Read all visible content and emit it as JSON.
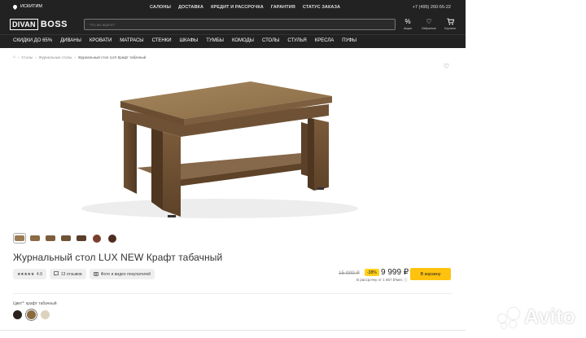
{
  "header": {
    "city": "ИСКИТИМ",
    "topnav": [
      "САЛОНЫ",
      "ДОСТАВКА",
      "КРЕДИТ И РАССРОЧКА",
      "ГАРАНТИЯ",
      "СТАТУС ЗАКАЗА"
    ],
    "phone": "+7 (495) 260-55-22",
    "logo_box": "DIVAN",
    "logo_text": "BOSS",
    "search_placeholder": "Что вы ищете?",
    "icons": [
      {
        "icon": "percent-icon",
        "label": "Акции"
      },
      {
        "icon": "heart-icon",
        "label": "Избранное"
      },
      {
        "icon": "cart-icon",
        "label": "Корзина"
      }
    ],
    "categories": [
      "СКИДКИ ДО 65%",
      "ДИВАНЫ",
      "КРОВАТИ",
      "МАТРАСЫ",
      "СТЕНКИ",
      "ШКАФЫ",
      "ТУМБЫ",
      "КОМОДЫ",
      "СТОЛЫ",
      "СТУЛЬЯ",
      "КРЕСЛА",
      "ПУФЫ"
    ]
  },
  "breadcrumb": [
    "Столы",
    "Журнальные столы",
    "Журнальный стол LUX Крафт табачный"
  ],
  "product": {
    "title": "Журнальный стол LUX NEW Крафт табачный",
    "rating_stars": "★★★★★",
    "rating": "4.9",
    "reviews": "13 отзывов",
    "photos": "Фото и видео покупателей",
    "price_old": "15 999 ₽",
    "discount": "-38%",
    "price": "9 999 ₽",
    "installment": "В рассрочку от 1 667 ₽/мес ⓘ",
    "cart_button": "В корзину",
    "color_label": "Цвет*: крафт табачный"
  },
  "colors": {
    "header_bg": "#222222",
    "accent": "#ffc20e",
    "swatches": [
      "#2a211d",
      "#8b6a3e",
      "#ddd2be"
    ]
  },
  "thumb_colors": [
    "#9a7a52",
    "#8c6b46",
    "#7c5e3c",
    "#6f5337",
    "#5a3e2a",
    "#7a3f2c",
    "#4e2c20"
  ],
  "watermark": "Avito"
}
